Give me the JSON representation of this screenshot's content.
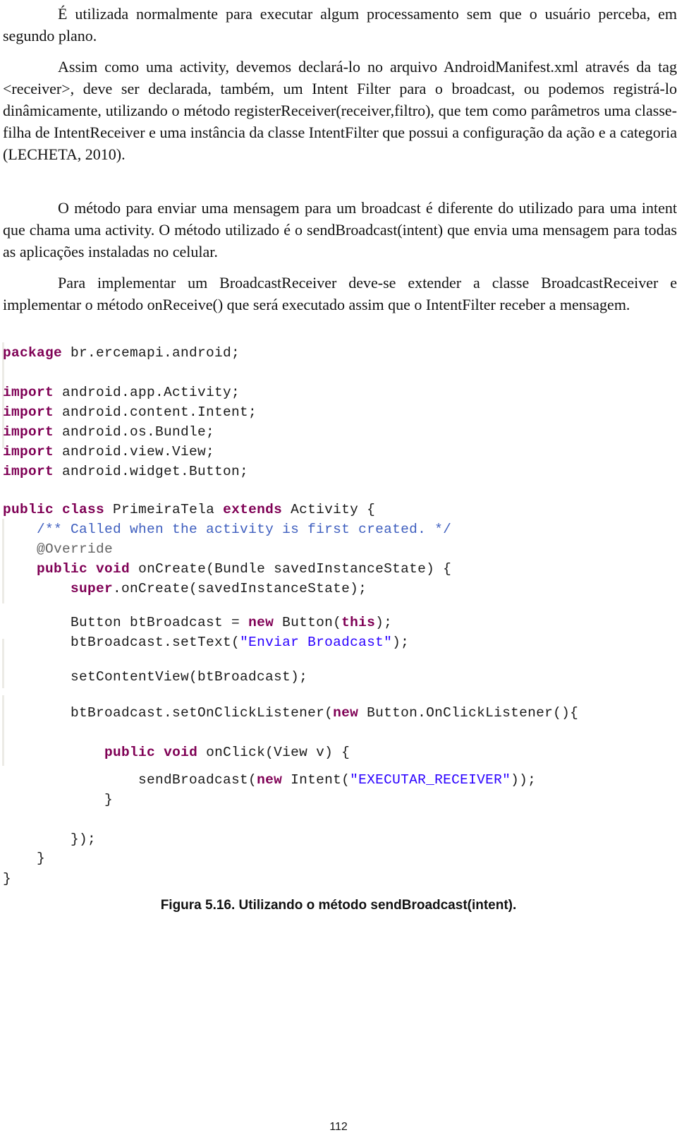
{
  "paragraphs": [
    {
      "text": "É utilizada normalmente para executar algum processamento sem que o usuário perceba, em segundo plano."
    },
    {
      "text": "Assim como uma activity, devemos declará-lo no arquivo AndroidManifest.xml através da tag <receiver>, deve ser declarada, também, um Intent Filter para o broadcast, ou podemos registrá-lo dinâmicamente, utilizando o método registerReceiver(receiver,filtro), que tem como parâmetros uma classe-filha de IntentReceiver e uma instância da classe IntentFilter que possui a configuração da ação e a categoria (LECHETA, 2010)."
    },
    {
      "text": "O método para enviar uma mensagem para um broadcast é diferente do utilizado para uma intent que chama uma activity. O método utilizado é o sendBroadcast(intent) que envia uma mensagem para todas as aplicações instaladas no celular."
    },
    {
      "text": "Para implementar um BroadcastReceiver deve-se extender a classe BroadcastReceiver e implementar o método onReceive() que será executado assim que o IntentFilter receber a mensagem."
    }
  ],
  "code_colors": {
    "keyword": "#7f0055",
    "comment": "#3f5fbf",
    "string": "#2a00ff",
    "annotation": "#646464",
    "default": "#1a1a1a"
  },
  "code_lines": [
    [
      {
        "t": "package",
        "c": "kw"
      },
      {
        "t": " br.ercemapi.android;"
      }
    ],
    [],
    [
      {
        "t": "import",
        "c": "kw"
      },
      {
        "t": " android.app.Activity;"
      }
    ],
    [
      {
        "t": "import",
        "c": "kw"
      },
      {
        "t": " android.content.Intent;"
      }
    ],
    [
      {
        "t": "import",
        "c": "kw"
      },
      {
        "t": " android.os.Bundle;"
      }
    ],
    [
      {
        "t": "import",
        "c": "kw"
      },
      {
        "t": " android.view.View;"
      }
    ],
    [
      {
        "t": "import",
        "c": "kw"
      },
      {
        "t": " android.widget.Button;"
      }
    ],
    [],
    [
      {
        "t": "public",
        "c": "kw"
      },
      {
        "t": " "
      },
      {
        "t": "class",
        "c": "kw"
      },
      {
        "t": " PrimeiraTela "
      },
      {
        "t": "extends",
        "c": "kw"
      },
      {
        "t": " Activity {"
      }
    ],
    [
      {
        "t": "    "
      },
      {
        "t": "/** Called when the activity is first created. */",
        "c": "cm"
      }
    ],
    [
      {
        "t": "    "
      },
      {
        "t": "@Override",
        "c": "an"
      }
    ],
    [
      {
        "t": "    "
      },
      {
        "t": "public",
        "c": "kw"
      },
      {
        "t": " "
      },
      {
        "t": "void",
        "c": "kw"
      },
      {
        "t": " onCreate(Bundle savedInstanceState) {"
      }
    ],
    [
      {
        "t": "        "
      },
      {
        "t": "super",
        "c": "kw"
      },
      {
        "t": ".onCreate(savedInstanceState);"
      }
    ],
    [],
    [
      {
        "t": "        Button btBroadcast = "
      },
      {
        "t": "new",
        "c": "kw"
      },
      {
        "t": " Button("
      },
      {
        "t": "this",
        "c": "kw"
      },
      {
        "t": ");"
      }
    ],
    [
      {
        "t": "        btBroadcast.setText("
      },
      {
        "t": "\"Enviar Broadcast\"",
        "c": "st"
      },
      {
        "t": ");"
      }
    ],
    [],
    [
      {
        "t": "        setContentView(btBroadcast);"
      }
    ],
    [],
    [
      {
        "t": "        btBroadcast.setOnClickListener("
      },
      {
        "t": "new",
        "c": "kw"
      },
      {
        "t": " Button.OnClickListener(){"
      }
    ],
    [],
    [
      {
        "t": "            "
      },
      {
        "t": "public",
        "c": "kw"
      },
      {
        "t": " "
      },
      {
        "t": "void",
        "c": "kw"
      },
      {
        "t": " onClick(View v) {"
      }
    ],
    [],
    [
      {
        "t": "                sendBroadcast("
      },
      {
        "t": "new",
        "c": "kw"
      },
      {
        "t": " Intent("
      },
      {
        "t": "\"EXECUTAR_RECEIVER\"",
        "c": "st"
      },
      {
        "t": "));"
      }
    ],
    [
      {
        "t": "            }"
      }
    ],
    [],
    [
      {
        "t": "        });"
      }
    ],
    [
      {
        "t": "    }"
      }
    ],
    [
      {
        "t": "}"
      }
    ]
  ],
  "caption": "Figura 5.16. Utilizando o método sendBroadcast(intent).",
  "page_number": "112"
}
